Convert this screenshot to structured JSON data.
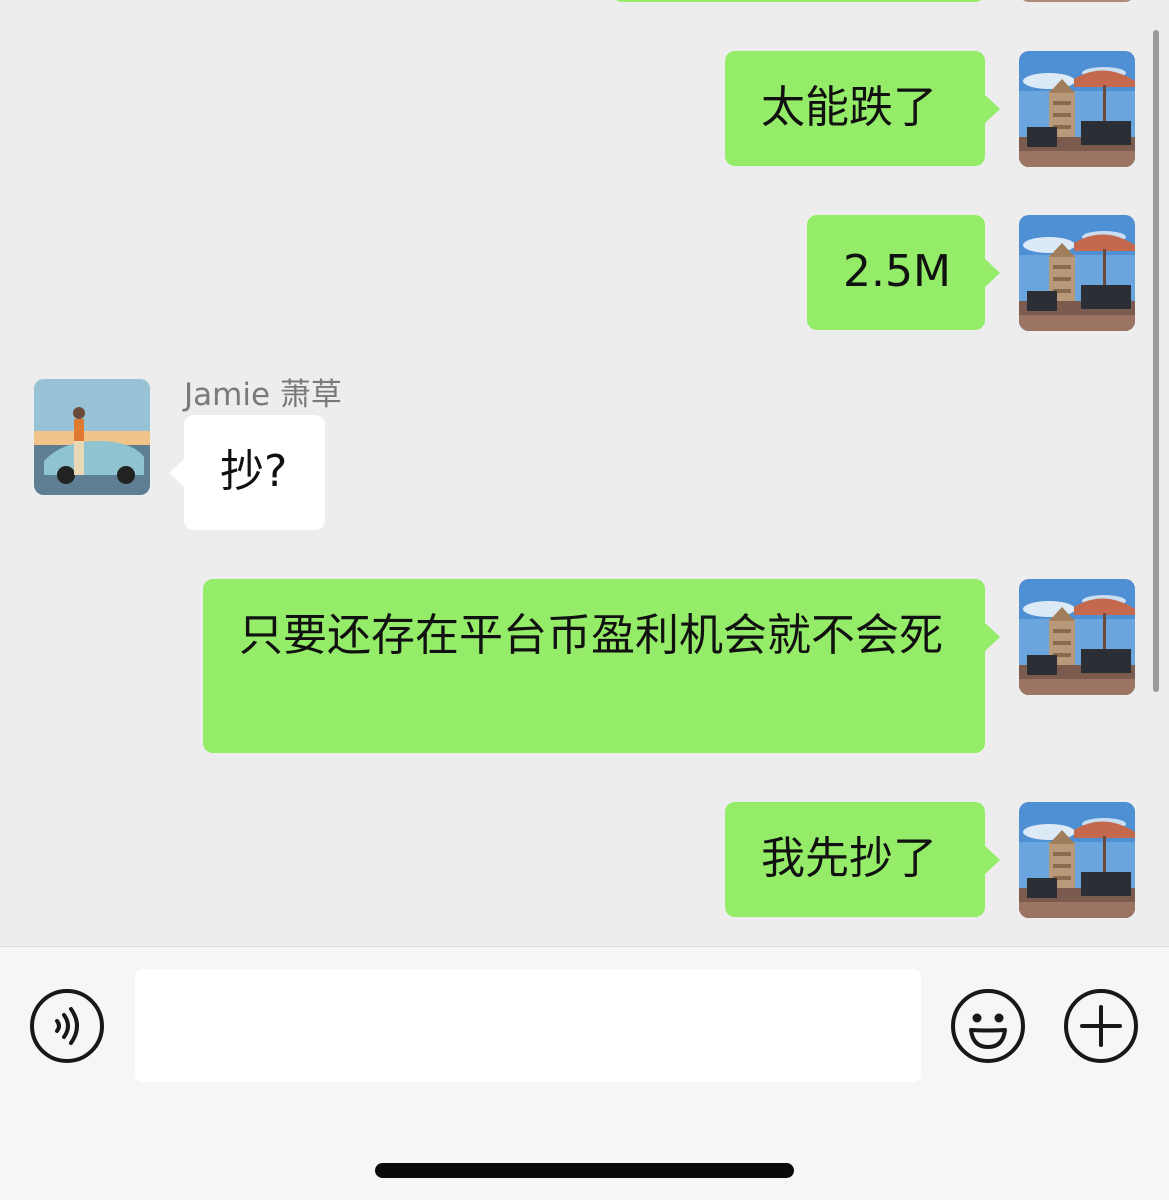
{
  "chat": {
    "messages": [
      {
        "from": "me",
        "text": "太能跌了"
      },
      {
        "from": "me",
        "text": "2.5M"
      },
      {
        "from": "other",
        "sender": "Jamie 萧草",
        "text": "抄?"
      },
      {
        "from": "me",
        "text": "只要还存在平台币盈利机会就不会死"
      },
      {
        "from": "me",
        "text": "我先抄了"
      }
    ]
  },
  "input_bar": {
    "voice_icon": "voice-icon",
    "emoji_icon": "emoji-icon",
    "add_icon": "plus-icon",
    "message_value": ""
  },
  "colors": {
    "outgoing_bubble": "#95ec69",
    "incoming_bubble": "#ffffff",
    "background": "#ededed"
  }
}
